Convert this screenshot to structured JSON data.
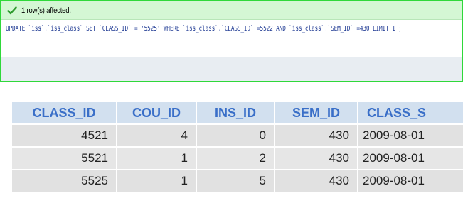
{
  "message": {
    "status_icon": "check-icon",
    "status_text": "1 row(s) affected.",
    "sql": "UPDATE `iss`.`iss_class` SET `CLASS_ID` = '5525' WHERE `iss_class`.`CLASS_ID` =5522 AND `iss_class`.`SEM_ID` =430 LIMIT 1 ;",
    "colors": {
      "border": "#2fd83a",
      "header_bg": "#d4f7d4",
      "sql_text": "#1f3a93"
    }
  },
  "grid": {
    "columns": [
      "CLASS_ID",
      "COU_ID",
      "INS_ID",
      "SEM_ID",
      "CLASS_S"
    ],
    "rows": [
      [
        "4521",
        "4",
        "0",
        "430",
        "2009-08-01"
      ],
      [
        "5521",
        "1",
        "2",
        "430",
        "2009-08-01"
      ],
      [
        "5525",
        "1",
        "5",
        "430",
        "2009-08-01"
      ]
    ],
    "colors": {
      "header_bg": "#d2e0ef",
      "header_text": "#3a6fc8",
      "row_bg": "#e1e1e1"
    }
  }
}
